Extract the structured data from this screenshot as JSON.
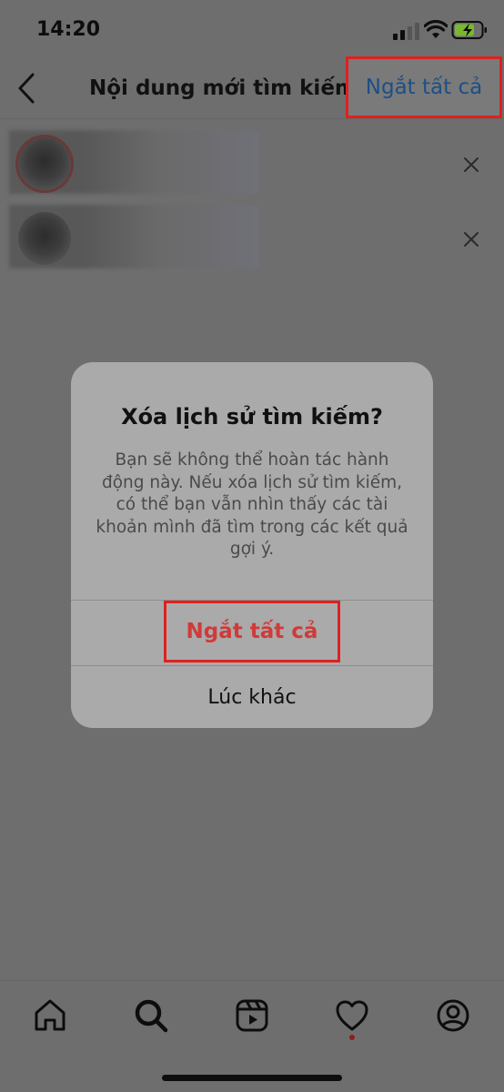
{
  "status_bar": {
    "time": "14:20",
    "icons": [
      "cellular-signal-icon",
      "wifi-icon",
      "battery-charging-icon"
    ],
    "battery_color": "#7ab82e"
  },
  "header": {
    "back_icon": "chevron-left-icon",
    "title": "Nội dung mới tìm kiếm",
    "clear_all_label": "Ngắt tất cả"
  },
  "recent_searches": [
    {
      "avatar": "avatar-blurred",
      "remove_icon": "close-icon"
    },
    {
      "avatar": "avatar-blurred",
      "remove_icon": "close-icon"
    }
  ],
  "dialog": {
    "title": "Xóa lịch sử tìm kiếm?",
    "body_lines": [
      "Bạn sẽ không thể hoàn tác hành",
      "động này. Nếu xóa lịch sử tìm kiếm,",
      "có thể bạn vẫn nhìn thấy các tài",
      "khoản mình đã tìm trong các kết quả",
      "gợi ý."
    ],
    "confirm_label": "Ngắt tất cả",
    "cancel_label": "Lúc khác"
  },
  "bottom_nav": {
    "items": [
      "home-icon",
      "search-icon",
      "reels-icon",
      "heart-icon",
      "profile-icon"
    ]
  },
  "colors": {
    "overlay": "#6e6e6e",
    "highlight": "#e02020",
    "link_blue": "#1d4f86",
    "destructive_red": "#d13a3a"
  }
}
